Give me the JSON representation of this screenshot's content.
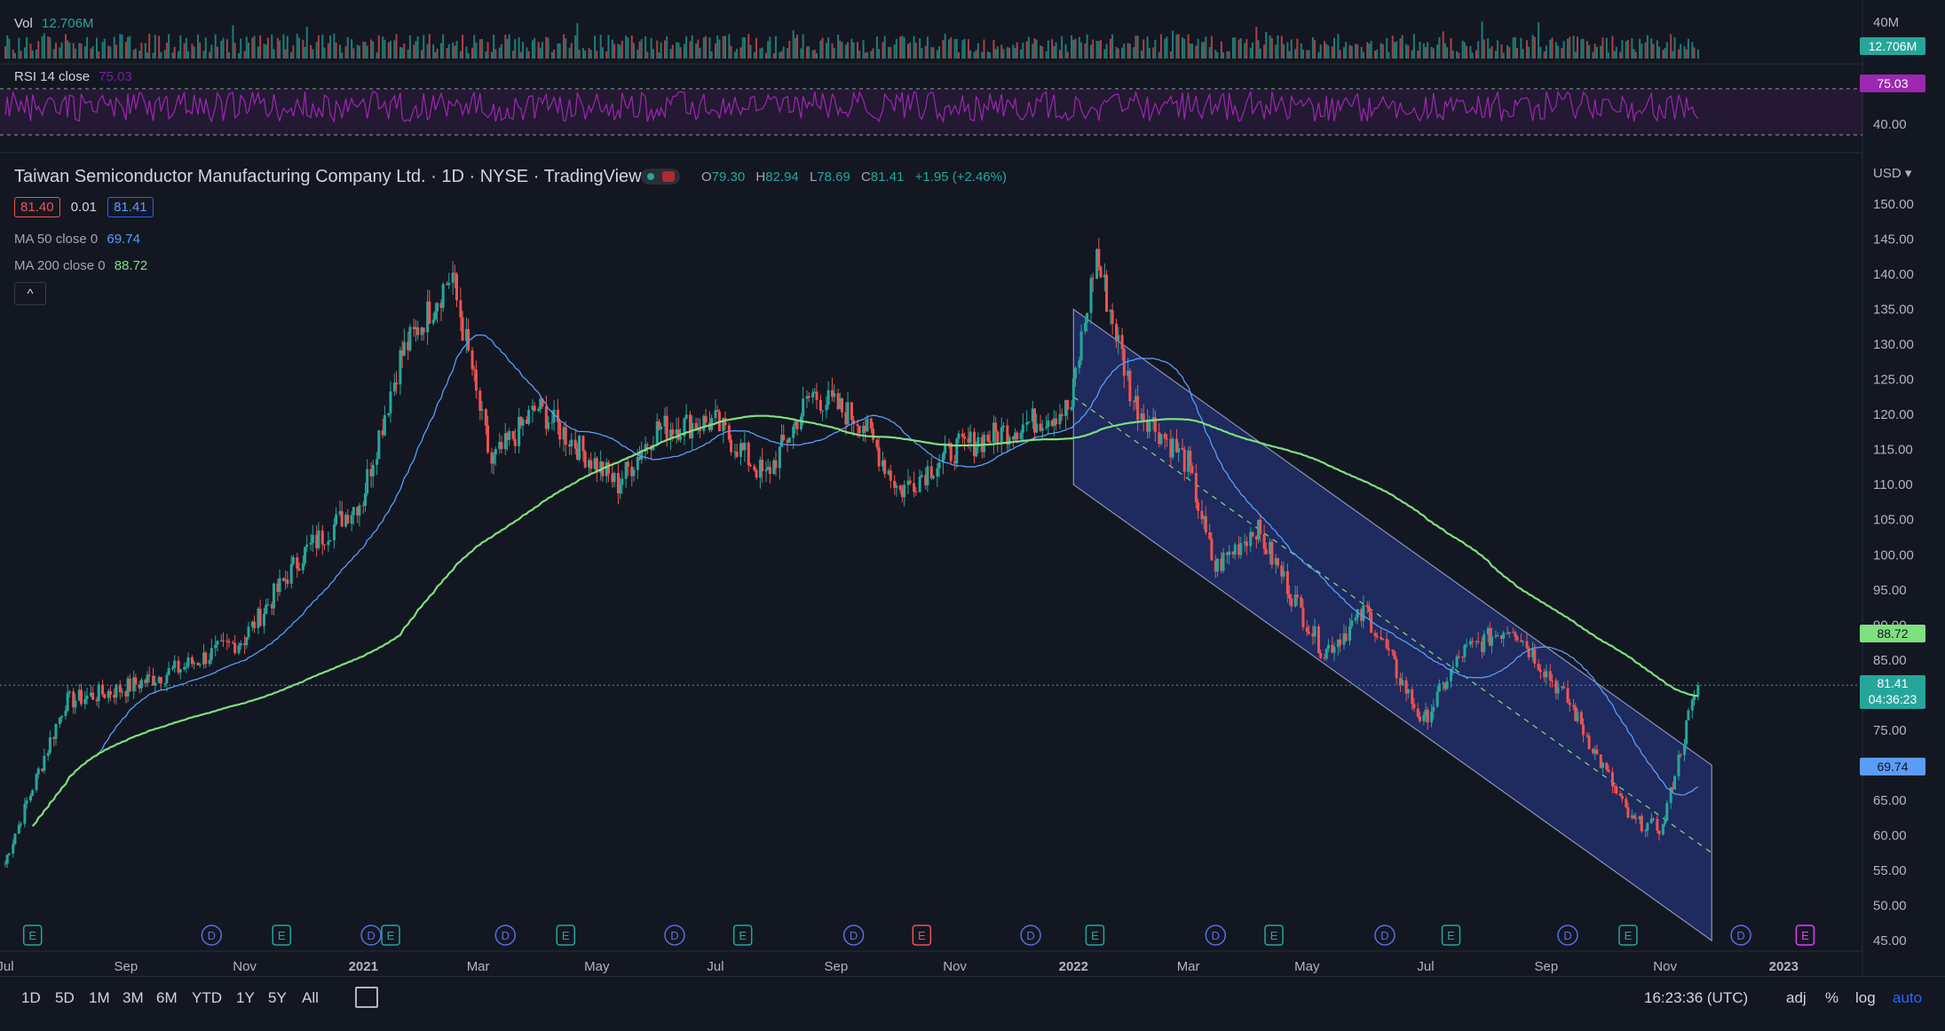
{
  "header": {
    "title": "Taiwan Semiconductor Manufacturing Company Ltd. · 1D · NYSE · TradingView",
    "ohlc": {
      "o_label": "O",
      "o": "79.30",
      "h_label": "H",
      "h": "82.94",
      "l_label": "L",
      "l": "78.69",
      "c_label": "C",
      "c": "81.41",
      "change": "+1.95 (+2.46%)"
    },
    "bid": "81.40",
    "spread": "0.01",
    "ask": "81.41",
    "ma50": {
      "label": "MA 50 close 0",
      "value": "69.74"
    },
    "ma200": {
      "label": "MA 200 close 0",
      "value": "88.72"
    },
    "collapse": "^"
  },
  "volume_pane": {
    "label": "Vol",
    "value": "12.706M",
    "axis_top": "40M",
    "last_badge": "12.706M"
  },
  "rsi_pane": {
    "label": "RSI 14 close",
    "value": "75.03",
    "axis_mid": "40.00",
    "last_badge": "75.03"
  },
  "price_axis": {
    "currency": "USD ▾",
    "ticks": [
      "150.00",
      "145.00",
      "140.00",
      "135.00",
      "130.00",
      "125.00",
      "120.00",
      "115.00",
      "110.00",
      "105.00",
      "100.00",
      "95.00",
      "90.00",
      "85.00",
      "80.00",
      "75.00",
      "70.00",
      "65.00",
      "60.00",
      "55.00",
      "50.00",
      "45.00"
    ],
    "badges": {
      "ma200": "88.72",
      "last": "81.41",
      "countdown": "04:36:23",
      "ma50": "69.74"
    }
  },
  "time_axis": [
    "Jul",
    "Sep",
    "Nov",
    "2021",
    "Mar",
    "May",
    "Jul",
    "Sep",
    "Nov",
    "2022",
    "Mar",
    "May",
    "Jul",
    "Sep",
    "Nov",
    "2023"
  ],
  "events": [
    "E",
    "D",
    "E",
    "D",
    "E",
    "D",
    "E",
    "D",
    "E",
    "D",
    "E",
    "D",
    "E",
    "D",
    "E",
    "D",
    "E",
    "D",
    "E",
    "D",
    "E"
  ],
  "toolbar": {
    "ranges": [
      "1D",
      "5D",
      "1M",
      "3M",
      "6M",
      "YTD",
      "1Y",
      "5Y",
      "All"
    ],
    "clock": "16:23:36 (UTC)",
    "adj": "adj",
    "pct": "%",
    "log": "log",
    "auto": "auto"
  },
  "colors": {
    "up": "#26a69a",
    "down": "#ef5350",
    "ma50": "#5b9cf6",
    "ma200": "#7ee07e",
    "rsi": "#9c27b0",
    "channel": "#2a3a8f"
  },
  "chart_data": {
    "type": "candlestick",
    "symbol": "TSM",
    "exchange": "NYSE",
    "interval": "1D",
    "ylim": [
      45,
      150
    ],
    "x_range": [
      "2020-07-01",
      "2023-01-15"
    ],
    "key_points": [
      {
        "date": "2020-07-01",
        "close": 56
      },
      {
        "date": "2020-08-01",
        "close": 79
      },
      {
        "date": "2020-09-01",
        "close": 81
      },
      {
        "date": "2020-10-01",
        "close": 84
      },
      {
        "date": "2020-11-01",
        "close": 88
      },
      {
        "date": "2020-12-01",
        "close": 100
      },
      {
        "date": "2021-01-01",
        "close": 108
      },
      {
        "date": "2021-01-20",
        "close": 128
      },
      {
        "date": "2021-02-16",
        "close": 140
      },
      {
        "date": "2021-03-08",
        "close": 113
      },
      {
        "date": "2021-04-01",
        "close": 121
      },
      {
        "date": "2021-05-12",
        "close": 110
      },
      {
        "date": "2021-06-01",
        "close": 118
      },
      {
        "date": "2021-07-01",
        "close": 119
      },
      {
        "date": "2021-07-27",
        "close": 111
      },
      {
        "date": "2021-08-20",
        "close": 123
      },
      {
        "date": "2021-09-15",
        "close": 119
      },
      {
        "date": "2021-10-04",
        "close": 109
      },
      {
        "date": "2021-11-01",
        "close": 115
      },
      {
        "date": "2021-12-01",
        "close": 118
      },
      {
        "date": "2021-12-31",
        "close": 121
      },
      {
        "date": "2022-01-13",
        "close": 143
      },
      {
        "date": "2022-02-01",
        "close": 122
      },
      {
        "date": "2022-03-01",
        "close": 113
      },
      {
        "date": "2022-03-15",
        "close": 98
      },
      {
        "date": "2022-04-05",
        "close": 104
      },
      {
        "date": "2022-05-10",
        "close": 86
      },
      {
        "date": "2022-06-01",
        "close": 92
      },
      {
        "date": "2022-06-30",
        "close": 76
      },
      {
        "date": "2022-07-20",
        "close": 86
      },
      {
        "date": "2022-08-15",
        "close": 90
      },
      {
        "date": "2022-09-15",
        "close": 78
      },
      {
        "date": "2022-10-15",
        "close": 62
      },
      {
        "date": "2022-10-31",
        "close": 61
      },
      {
        "date": "2022-11-11",
        "close": 74
      },
      {
        "date": "2022-11-18",
        "close": 81.41
      }
    ],
    "last": {
      "open": 79.3,
      "high": 82.94,
      "low": 78.69,
      "close": 81.41
    },
    "ma50_last": 69.74,
    "ma200_last": 88.72,
    "rsi_last": 75.03,
    "volume_last": "12.706M",
    "channel": {
      "start": {
        "date": "2022-01-01",
        "upper": 135,
        "lower": 110
      },
      "end": {
        "date": "2022-11-25",
        "upper": 70,
        "lower": 45
      }
    }
  }
}
